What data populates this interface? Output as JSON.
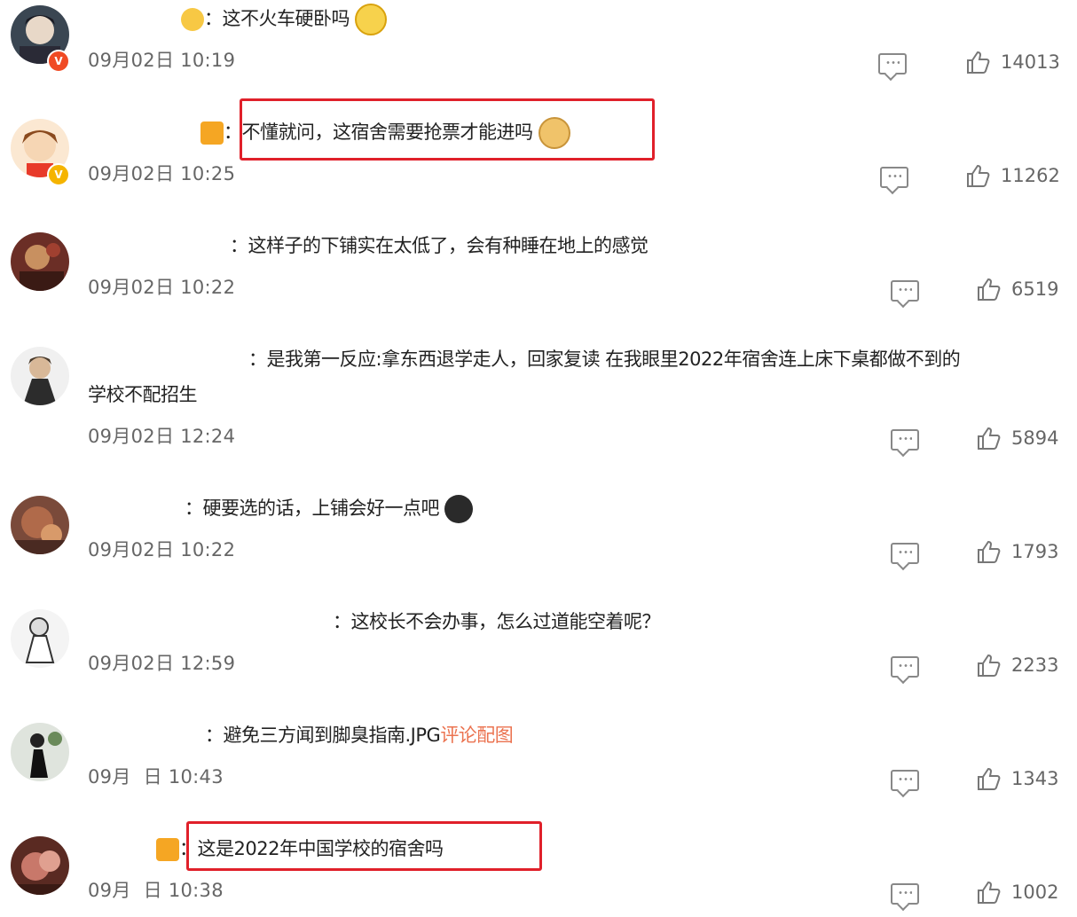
{
  "comments": [
    {
      "text": "：这不火车硬卧吗",
      "time": "09月02日 10:19",
      "likes": "14013",
      "badge": "V",
      "badge_color": "#f04a24",
      "avatar_color": "#3a4652"
    },
    {
      "text": "：不懂就问，这宿舍需要抢票才能进吗",
      "time": "09月02日 10:25",
      "likes": "11262",
      "badge": "V",
      "badge_color": "#f5b400",
      "avatar_color": "#8a5a2b"
    },
    {
      "text": "：这样子的下铺实在太低了，会有种睡在地上的感觉",
      "time": "09月02日 10:22",
      "likes": "6519",
      "avatar_color": "#6b2e26"
    },
    {
      "text": "：是我第一反应:拿东西退学走人，回家复读 在我眼里2022年宿舍连上床下桌都做不到的",
      "text2": "学校不配招生",
      "time": "09月02日 12:24",
      "likes": "5894",
      "avatar_color": "#4c4a3e"
    },
    {
      "text": "：硬要选的话，上铺会好一点吧",
      "time": "09月02日 10:22",
      "likes": "1793",
      "avatar_color": "#7a4a3a"
    },
    {
      "text": "：这校长不会办事，怎么过道能空着呢？",
      "time": "09月02日 12:59",
      "likes": "2233",
      "avatar_color": "#d8d8d8"
    },
    {
      "text": "：避免三方闻到脚臭指南.JPG",
      "link": "评论配图",
      "time": "09月  日 10:43",
      "likes": "1343",
      "avatar_color": "#9aa59a"
    },
    {
      "text": "：这是2022年中国学校的宿舍吗",
      "time": "09月  日 10:38",
      "likes": "1002",
      "avatar_color": "#5a2a22"
    }
  ],
  "colors": {
    "highlight_box": "#e0202a",
    "link": "#eb7350",
    "meta": "#666666"
  }
}
